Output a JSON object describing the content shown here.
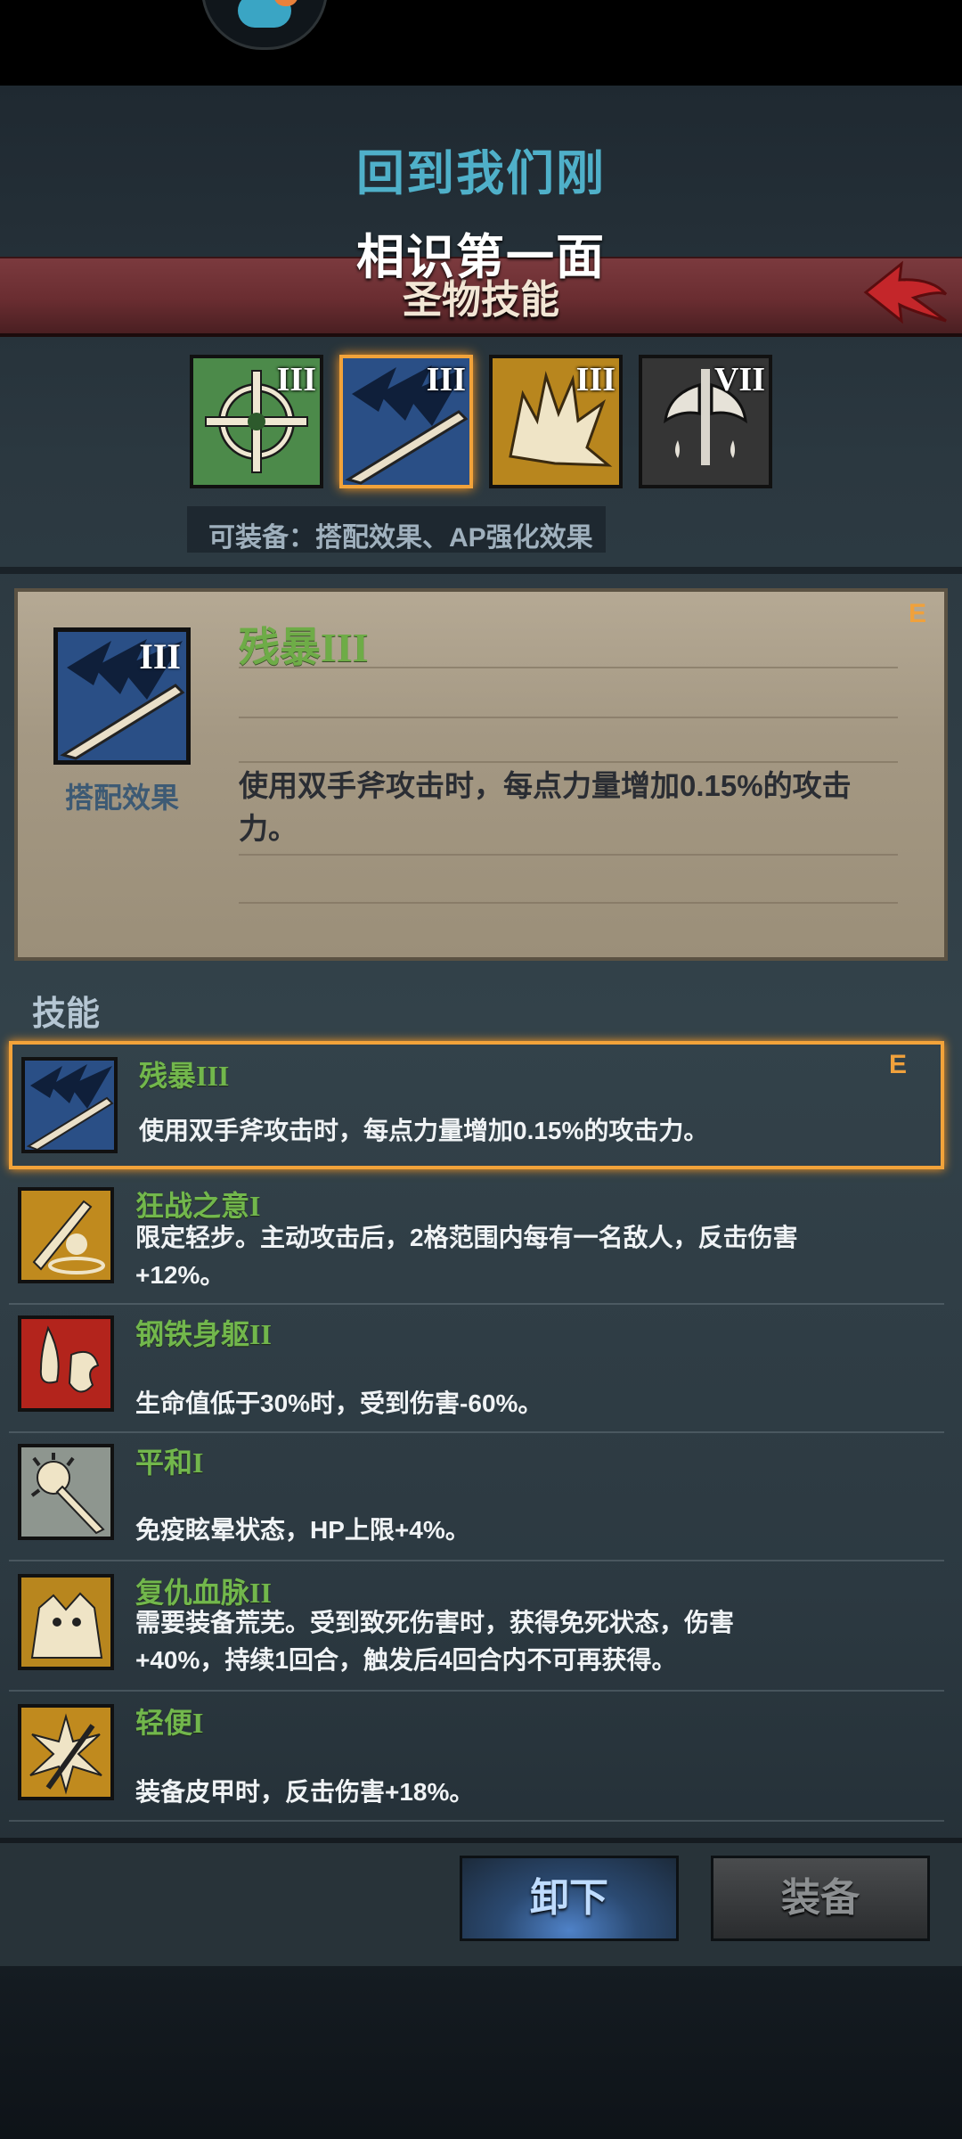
{
  "notification": {
    "line1": "回到我们刚",
    "line2": "相识第一面"
  },
  "header": {
    "title": "圣物技能"
  },
  "relics": [
    {
      "numeral": "III",
      "icon": "crosshair-icon",
      "color": "#4c8a4a"
    },
    {
      "numeral": "III",
      "icon": "claw-slash-icon",
      "color": "#2a4f86",
      "selected": true
    },
    {
      "numeral": "III",
      "icon": "beast-fur-icon",
      "color": "#b8861e"
    },
    {
      "numeral": "VII",
      "icon": "axe-drip-icon",
      "color": "#3a3a3a"
    }
  ],
  "equip_note": "可装备：搭配效果、AP强化效果",
  "detail": {
    "numeral": "III",
    "name": "残暴III",
    "tag": "E",
    "caption": "搭配效果",
    "description": "使用双手斧攻击时，每点力量增加0.15%的攻击力。"
  },
  "skills_label": "技能",
  "skills": [
    {
      "name": "残暴III",
      "description": "使用双手斧攻击时，每点力量增加0.15%的攻击力。",
      "tag": "E",
      "icon": "claw-slash-icon",
      "selected": true
    },
    {
      "name": "狂战之意I",
      "description": "限定轻步。主动攻击后，2格范围内每有一名敌人，反击伤害+12%。",
      "icon": "berserker-sword-icon"
    },
    {
      "name": "钢铁身躯II",
      "description": "生命值低于30%时，受到伤害-60%。",
      "icon": "iron-body-icon"
    },
    {
      "name": "平和I",
      "description": "免疫眩晕状态，HP上限+4%。",
      "icon": "mace-icon"
    },
    {
      "name": "复仇血脉II",
      "description": "需要装备荒芜。受到致死伤害时，获得免死状态，伤害+40%，持续1回合，触发后4回合内不可再获得。",
      "icon": "vengeance-beast-icon"
    },
    {
      "name": "轻便I",
      "description": "装备皮甲时，反击伤害+18%。",
      "icon": "burst-arrow-icon"
    }
  ],
  "buttons": {
    "unequip": "卸下",
    "equip": "装备"
  }
}
